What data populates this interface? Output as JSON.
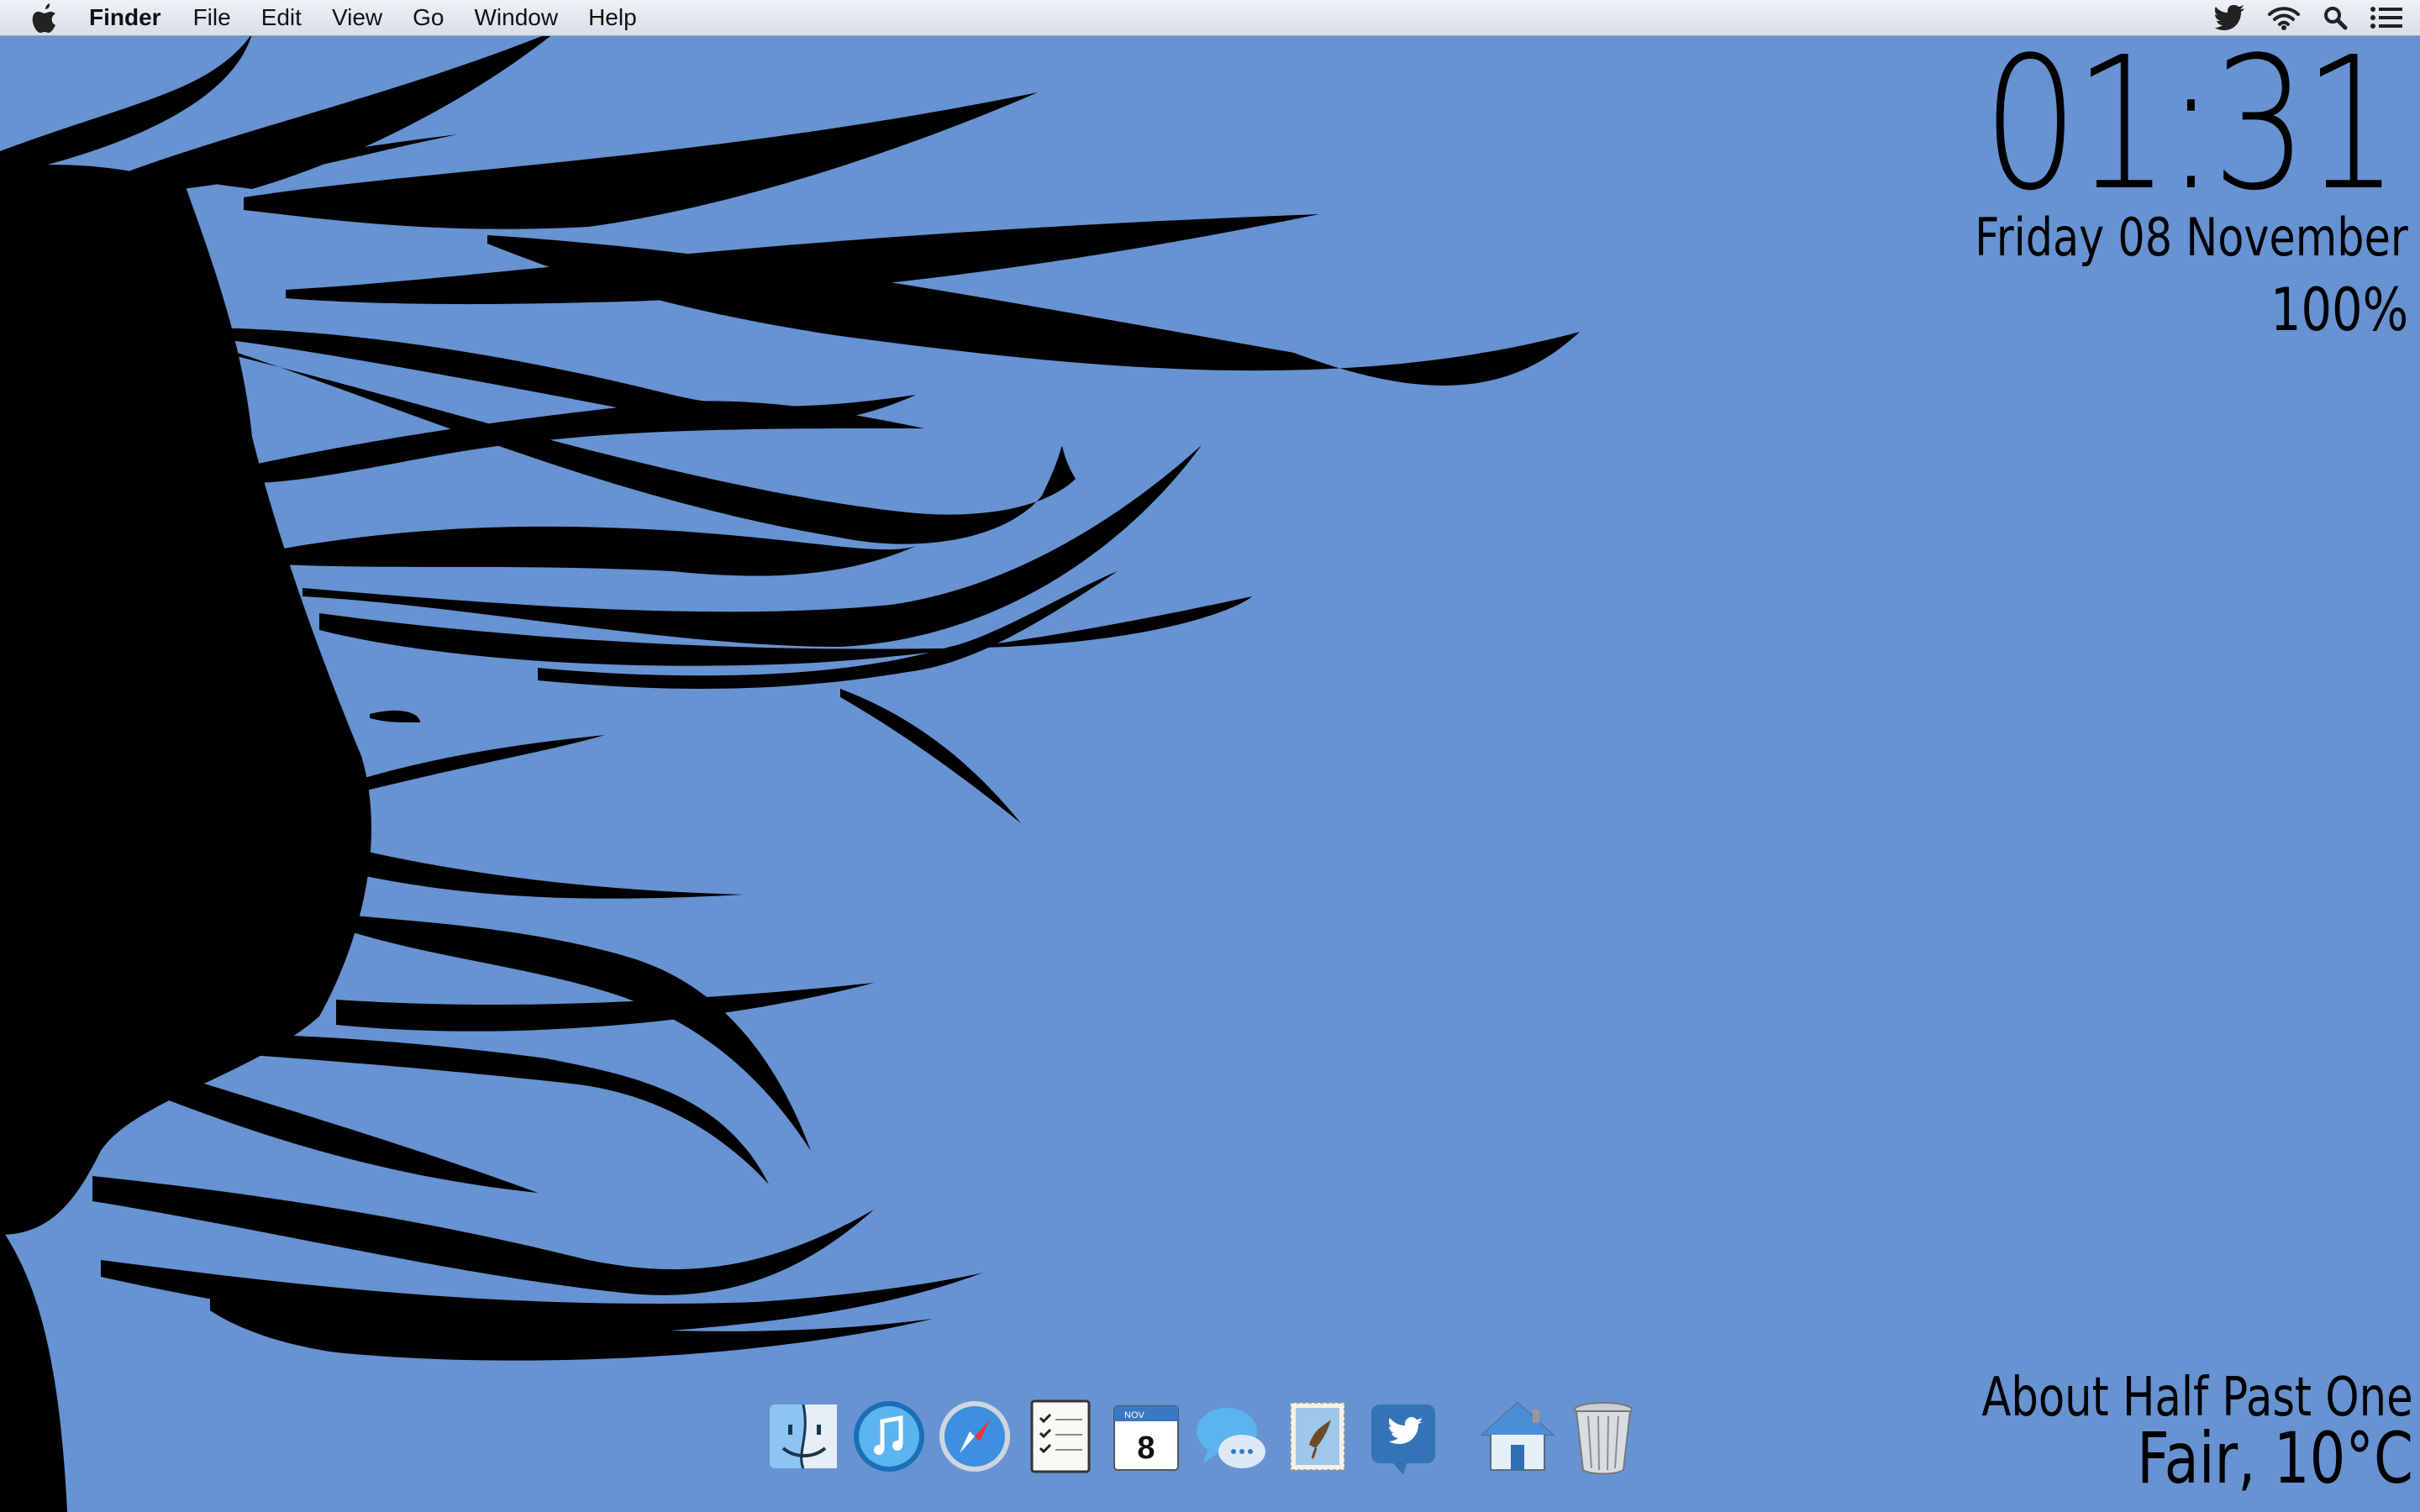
{
  "menubar": {
    "apple_icon": "apple-icon",
    "items": [
      {
        "label": "Finder",
        "bold": true
      },
      {
        "label": "File"
      },
      {
        "label": "Edit"
      },
      {
        "label": "View"
      },
      {
        "label": "Go"
      },
      {
        "label": "Window"
      },
      {
        "label": "Help"
      }
    ],
    "status_icons": [
      "twitter-icon",
      "wifi-icon",
      "spotlight-search-icon",
      "notification-center-icon"
    ]
  },
  "widgets": {
    "time": "01:31",
    "date": "Friday 08 November",
    "battery": "100%",
    "fuzzy_time": "About Half Past One",
    "weather": "Fair, 10°C"
  },
  "dock": {
    "items": [
      {
        "name": "finder",
        "icon": "finder-icon"
      },
      {
        "name": "itunes",
        "icon": "itunes-icon"
      },
      {
        "name": "safari",
        "icon": "safari-icon"
      },
      {
        "name": "reminders",
        "icon": "reminders-icon"
      },
      {
        "name": "calendar",
        "icon": "calendar-icon",
        "badge_month": "NOV",
        "badge_day": "8"
      },
      {
        "name": "messages",
        "icon": "messages-icon"
      },
      {
        "name": "mail",
        "icon": "mail-stamp-icon"
      },
      {
        "name": "twitter",
        "icon": "twitter-app-icon"
      },
      {
        "name": "home-folder",
        "icon": "home-folder-icon"
      },
      {
        "name": "trash",
        "icon": "trash-icon"
      }
    ]
  },
  "colors": {
    "wallpaper": "#6793d2",
    "silhouette": "#000000",
    "menubar": "#e6ebf1"
  }
}
